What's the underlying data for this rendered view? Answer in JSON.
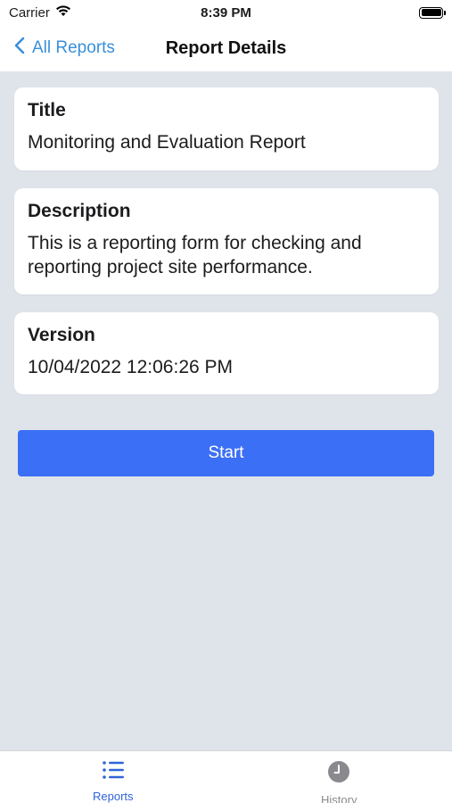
{
  "status_bar": {
    "carrier": "Carrier",
    "time": "8:39 PM"
  },
  "nav": {
    "back_label": "All Reports",
    "title": "Report Details"
  },
  "cards": {
    "title": {
      "label": "Title",
      "value": "Monitoring and Evaluation Report"
    },
    "description": {
      "label": "Description",
      "value_line1": "This is a reporting form for checking and",
      "value_line2": "reporting project site performance."
    },
    "version": {
      "label": "Version",
      "value": "10/04/2022 12:06:26 PM"
    }
  },
  "actions": {
    "start_label": "Start"
  },
  "tab_bar": {
    "tabs": [
      {
        "label": "Reports",
        "icon": "list-icon",
        "active": true
      },
      {
        "label": "History",
        "icon": "clock-icon",
        "active": false
      }
    ]
  },
  "colors": {
    "accent": "#3b6ff5",
    "link": "#3a8fd9",
    "background": "#dfe4ea",
    "tab_active": "#2f64d6",
    "tab_inactive": "#8a8a8e"
  }
}
